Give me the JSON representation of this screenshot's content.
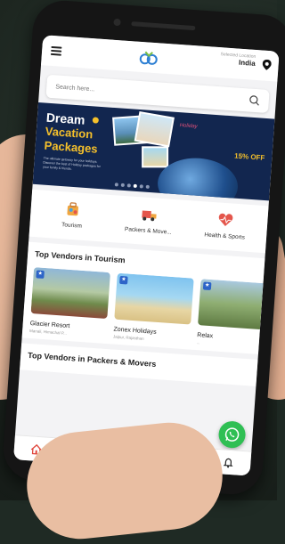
{
  "header": {
    "location_caption": "Selected Location",
    "location_value": "India"
  },
  "search": {
    "placeholder": "Search here..."
  },
  "banner": {
    "line1": "Dream",
    "line2": "Vacation",
    "line3": "Packages",
    "fine_print": "The ultimate getaway for your holidays. Discover the best of Holiday packages for your family & friends.",
    "brand": "Holiday",
    "discount": "15% OFF",
    "slide_count": 6,
    "active_slide": 4
  },
  "categories": [
    {
      "label": "Tourism",
      "icon": "tourism-icon"
    },
    {
      "label": "Packers & Move...",
      "icon": "truck-icon"
    },
    {
      "label": "Health & Sports",
      "icon": "heart-icon"
    }
  ],
  "tourism_section": {
    "title": "Top Vendors in Tourism",
    "vendors": [
      {
        "name": "Glacier Resort",
        "place": "Manali, Himachal P..."
      },
      {
        "name": "Zonex Holidays",
        "place": "Jaipur, Rajasthan"
      },
      {
        "name": "Relax",
        "place": "..."
      }
    ]
  },
  "movers_section": {
    "title": "Top Vendors in Packers & Movers"
  },
  "bottom_nav": [
    "home-icon",
    "heart-icon",
    "instagram-icon",
    "briefcase-icon",
    "bell-icon"
  ],
  "colors": {
    "banner_bg": "#12264f",
    "accent_yellow": "#f5c02b",
    "whatsapp_green": "#2fbf54",
    "nav_active": "#e0463c"
  }
}
